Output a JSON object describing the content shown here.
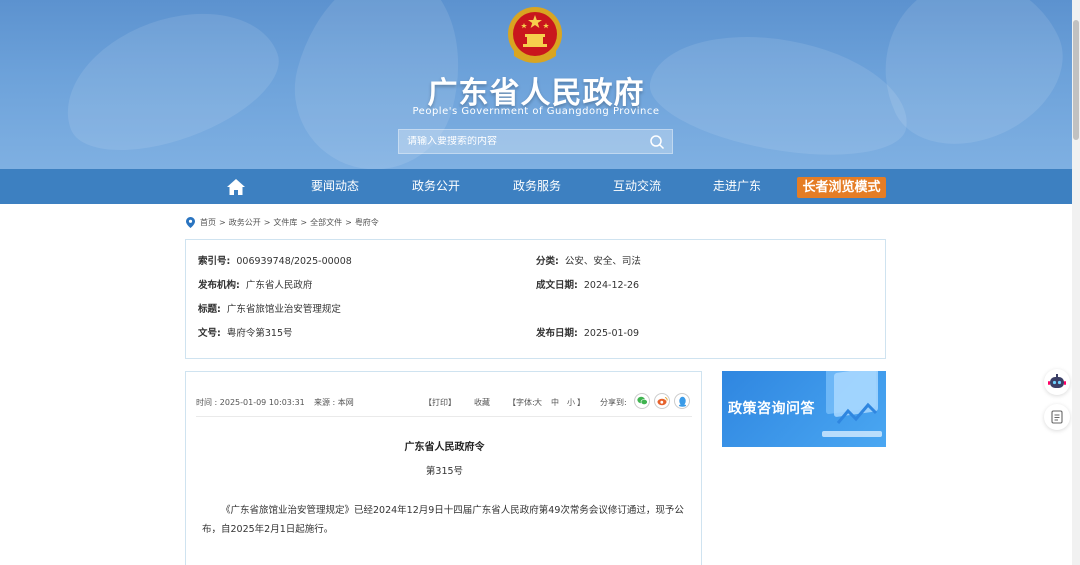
{
  "header": {
    "title": "广东省人民政府",
    "subtitle": "People's Government of Guangdong Province",
    "search_placeholder": "请输入要搜索的内容"
  },
  "nav": {
    "items": [
      {
        "label": "要闻动态"
      },
      {
        "label": "政务公开"
      },
      {
        "label": "政务服务"
      },
      {
        "label": "互动交流"
      },
      {
        "label": "走进广东"
      }
    ],
    "elder_mode": "长者浏览模式"
  },
  "breadcrumb": [
    "首页",
    "政务公开",
    "文件库",
    "全部文件",
    "粤府令"
  ],
  "breadcrumb_sep": ">",
  "info": {
    "index_label": "索引号:",
    "index_value": "006939748/2025-00008",
    "category_label": "分类:",
    "category_value": "公安、安全、司法",
    "issuer_label": "发布机构:",
    "issuer_value": "广东省人民政府",
    "created_label": "成文日期:",
    "created_value": "2024-12-26",
    "title_label": "标题:",
    "title_value": "广东省旅馆业治安管理规定",
    "docno_label": "文号:",
    "docno_value": "粤府令第315号",
    "published_label": "发布日期:",
    "published_value": "2025-01-09"
  },
  "article": {
    "time": "时间 : 2025-01-09 10:03:31",
    "source": "来源 : 本网",
    "print": "【打印】",
    "favorite": "收藏",
    "font_size_prefix": "【字体:",
    "font_large": "大",
    "font_medium": "中",
    "font_small": "小",
    "font_size_suffix": "】",
    "share_label": "分享到:",
    "doc_title": "广东省人民政府令",
    "doc_number": "第315号",
    "body": "《广东省旅馆业治安管理规定》已经2024年12月9日十四届广东省人民政府第49次常务会议修订通过，现予公布，自2025年2月1日起施行。"
  },
  "side_ad": {
    "text": "政策咨询问答"
  },
  "colors": {
    "banner": "#6da2da",
    "nav": "#3d80c1",
    "elder_button": "#e57d25",
    "box_border": "#cfe3f0"
  },
  "icons": [
    "home-icon",
    "search-icon",
    "location-pin-icon",
    "wechat-icon",
    "weibo-icon",
    "qq-icon",
    "robot-assistant-icon",
    "document-icon"
  ]
}
